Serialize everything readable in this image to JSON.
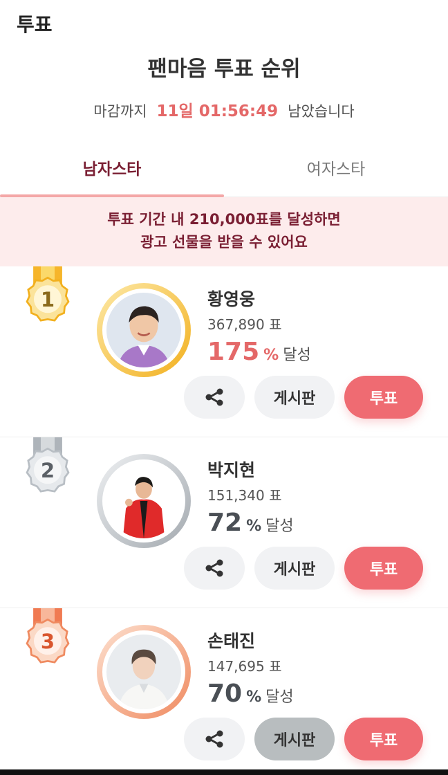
{
  "header": {
    "title": "투표"
  },
  "page": {
    "title": "팬마음 투표 순위"
  },
  "countdown": {
    "label_before": "마감까지",
    "time": "11일 01:56:49",
    "label_after": "남았습니다"
  },
  "tabs": [
    {
      "label": "남자스타",
      "active": true
    },
    {
      "label": "여자스타",
      "active": false
    }
  ],
  "banner": {
    "line1": "투표 기간 내 210,000표를 달성하면",
    "line2": "광고 선물을 받을 수 있어요"
  },
  "ranking": [
    {
      "rank": "1",
      "name": "황영웅",
      "votes": "367,890 표",
      "percent": "175",
      "pct_unit": "%",
      "achieve_label": "달성",
      "percent_color": "#e46868",
      "medal": "gold",
      "share_icon": "share-icon",
      "board_label": "게시판",
      "vote_label": "투표"
    },
    {
      "rank": "2",
      "name": "박지현",
      "votes": "151,340 표",
      "percent": "72",
      "pct_unit": "%",
      "achieve_label": "달성",
      "percent_color": "#4a4f55",
      "medal": "silver",
      "share_icon": "share-icon",
      "board_label": "게시판",
      "vote_label": "투표"
    },
    {
      "rank": "3",
      "name": "손태진",
      "votes": "147,695 표",
      "percent": "70",
      "pct_unit": "%",
      "achieve_label": "달성",
      "percent_color": "#4a4f55",
      "medal": "bronze",
      "share_icon": "share-icon",
      "board_label": "게시판",
      "vote_label": "투표"
    }
  ],
  "colors": {
    "accent": "#ef6b72",
    "tab_active": "#7a1f33",
    "banner_bg": "#fdecec",
    "gold": "#f2b01e",
    "silver": "#9aa1a8",
    "bronze": "#ef8a60"
  }
}
